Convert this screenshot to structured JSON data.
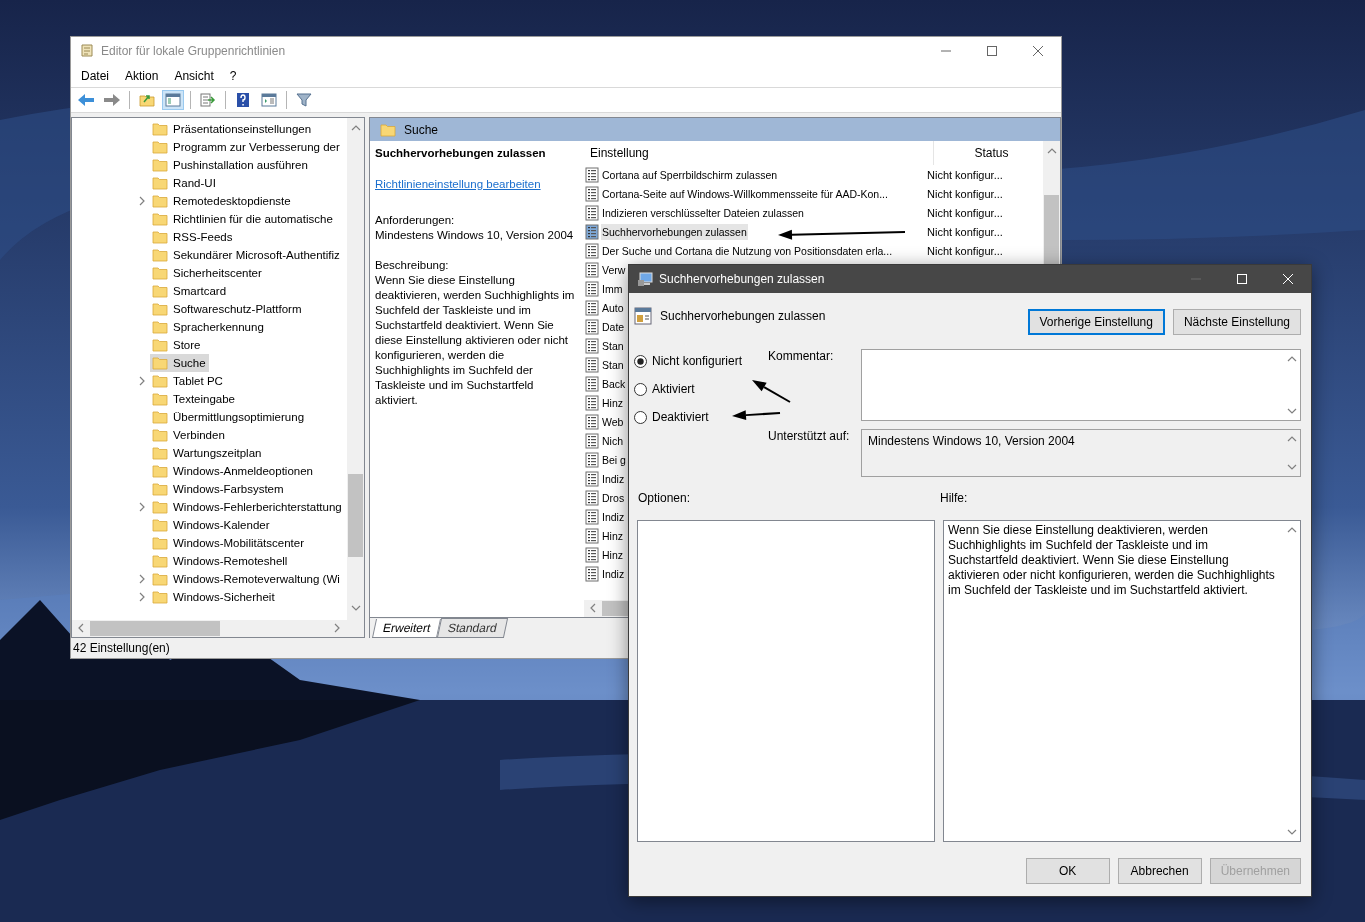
{
  "window": {
    "title": "Editor für lokale Gruppenrichtlinien"
  },
  "menu": [
    "Datei",
    "Aktion",
    "Ansicht",
    "?"
  ],
  "tree": {
    "items": [
      {
        "label": "Präsentationseinstellungen",
        "expandable": false,
        "selected": false
      },
      {
        "label": "Programm zur Verbesserung der",
        "expandable": false,
        "selected": false
      },
      {
        "label": "Pushinstallation ausführen",
        "expandable": false,
        "selected": false
      },
      {
        "label": "Rand-UI",
        "expandable": false,
        "selected": false
      },
      {
        "label": "Remotedesktopdienste",
        "expandable": true,
        "selected": false
      },
      {
        "label": "Richtlinien für die automatische",
        "expandable": false,
        "selected": false
      },
      {
        "label": "RSS-Feeds",
        "expandable": false,
        "selected": false
      },
      {
        "label": "Sekundärer Microsoft-Authentifiz",
        "expandable": false,
        "selected": false
      },
      {
        "label": "Sicherheitscenter",
        "expandable": false,
        "selected": false
      },
      {
        "label": "Smartcard",
        "expandable": false,
        "selected": false
      },
      {
        "label": "Softwareschutz-Plattform",
        "expandable": false,
        "selected": false
      },
      {
        "label": "Spracherkennung",
        "expandable": false,
        "selected": false
      },
      {
        "label": "Store",
        "expandable": false,
        "selected": false
      },
      {
        "label": "Suche",
        "expandable": false,
        "selected": true
      },
      {
        "label": "Tablet PC",
        "expandable": true,
        "selected": false
      },
      {
        "label": "Texteingabe",
        "expandable": false,
        "selected": false
      },
      {
        "label": "Übermittlungsoptimierung",
        "expandable": false,
        "selected": false
      },
      {
        "label": "Verbinden",
        "expandable": false,
        "selected": false
      },
      {
        "label": "Wartungszeitplan",
        "expandable": false,
        "selected": false
      },
      {
        "label": "Windows-Anmeldeoptionen",
        "expandable": false,
        "selected": false
      },
      {
        "label": "Windows-Farbsystem",
        "expandable": false,
        "selected": false
      },
      {
        "label": "Windows-Fehlerberichterstattung",
        "expandable": true,
        "selected": false
      },
      {
        "label": "Windows-Kalender",
        "expandable": false,
        "selected": false
      },
      {
        "label": "Windows-Mobilitätscenter",
        "expandable": false,
        "selected": false
      },
      {
        "label": "Windows-Remoteshell",
        "expandable": false,
        "selected": false
      },
      {
        "label": "Windows-Remoteverwaltung (Wi",
        "expandable": true,
        "selected": false
      },
      {
        "label": "Windows-Sicherheit",
        "expandable": true,
        "selected": false
      }
    ]
  },
  "details": {
    "header": "Suche",
    "title": "Suchhervorhebungen zulassen",
    "link": "Richtlinieneinstellung bearbeiten",
    "requirements_label": "Anforderungen:",
    "requirements": "Mindestens Windows 10, Version 2004",
    "description_label": "Beschreibung:",
    "description": "Wenn Sie diese Einstellung deaktivieren, werden Suchhighlights im Suchfeld der Taskleiste und im Suchstartfeld deaktiviert. Wenn Sie diese Einstellung aktivieren oder nicht konfigurieren, werden die Suchhighlights im Suchfeld der Taskleiste und im Suchstartfeld aktiviert."
  },
  "table": {
    "columns": [
      "Einstellung",
      "Status"
    ],
    "rows": [
      {
        "name": "Cortana auf Sperrbildschirm zulassen",
        "status": "Nicht konfigur...",
        "selected": false
      },
      {
        "name": "Cortana-Seite auf Windows-Willkommensseite für AAD-Kon...",
        "status": "Nicht konfigur...",
        "selected": false
      },
      {
        "name": "Indizieren verschlüsselter Dateien zulassen",
        "status": "Nicht konfigur...",
        "selected": false
      },
      {
        "name": "Suchhervorhebungen zulassen",
        "status": "Nicht konfigur...",
        "selected": true
      },
      {
        "name": "Der Suche und Cortana die Nutzung von Positionsdaten erla...",
        "status": "Nicht konfigur...",
        "selected": false
      },
      {
        "name": "Verw",
        "selected": false
      },
      {
        "name": "Imm",
        "selected": false
      },
      {
        "name": "Auto",
        "selected": false
      },
      {
        "name": "Date",
        "selected": false
      },
      {
        "name": "Stan",
        "selected": false
      },
      {
        "name": "Stan",
        "selected": false
      },
      {
        "name": "Back",
        "selected": false
      },
      {
        "name": "Hinz",
        "selected": false
      },
      {
        "name": "Web",
        "selected": false
      },
      {
        "name": "Nich",
        "selected": false
      },
      {
        "name": "Bei g",
        "selected": false
      },
      {
        "name": "Indiz",
        "selected": false
      },
      {
        "name": "Dros",
        "selected": false
      },
      {
        "name": "Indiz",
        "selected": false
      },
      {
        "name": "Hinz",
        "selected": false
      },
      {
        "name": "Hinz",
        "selected": false
      },
      {
        "name": "Indiz",
        "selected": false
      }
    ]
  },
  "view_tabs": [
    {
      "label": "Erweitert",
      "selected": true
    },
    {
      "label": "Standard",
      "selected": false
    }
  ],
  "status_bar": "42 Einstellung(en)",
  "dialog": {
    "title": "Suchhervorhebungen zulassen",
    "policy_name": "Suchhervorhebungen zulassen",
    "nav_buttons": [
      {
        "label": "Vorherige Einstellung",
        "focused": true
      },
      {
        "label": "Nächste Einstellung",
        "focused": false
      }
    ],
    "states": [
      {
        "label": "Nicht konfiguriert",
        "selected": true
      },
      {
        "label": "Aktiviert",
        "selected": false
      },
      {
        "label": "Deaktiviert",
        "selected": false
      }
    ],
    "comment_label": "Kommentar:",
    "supported_label": "Unterstützt auf:",
    "supported_value": "Mindestens Windows 10, Version 2004",
    "options_label": "Optionen:",
    "help_label": "Hilfe:",
    "help_text": "Wenn Sie diese Einstellung deaktivieren, werden Suchhighlights im Suchfeld der Taskleiste und im Suchstartfeld deaktiviert. Wenn Sie diese Einstellung aktivieren oder nicht konfigurieren, werden die Suchhighlights im Suchfeld der Taskleiste und im Suchstartfeld aktiviert.",
    "footer_buttons": [
      {
        "label": "OK",
        "disabled": false
      },
      {
        "label": "Abbrechen",
        "disabled": false
      },
      {
        "label": "Übernehmen",
        "disabled": true
      }
    ]
  }
}
